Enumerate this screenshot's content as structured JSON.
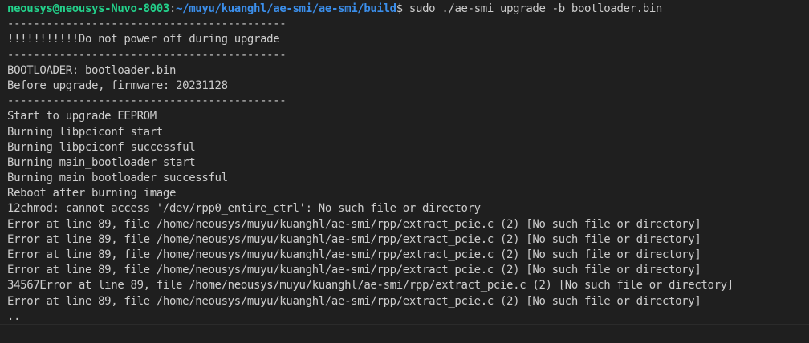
{
  "prompt": {
    "user_host": "neousys@neousys-Nuvo-8003",
    "separator": ":",
    "path": "~/muyu/kuanghl/ae-smi/ae-smi/build",
    "symbol": "$",
    "command": " sudo ./ae-smi upgrade -b bootloader.bin"
  },
  "output": [
    "-------------------------------------------",
    "!!!!!!!!!!!Do not power off during upgrade",
    "-------------------------------------------",
    "BOOTLOADER: bootloader.bin",
    "Before upgrade, firmware: 20231128",
    "-------------------------------------------",
    "Start to upgrade EEPROM",
    "Burning libpciconf start",
    "Burning libpciconf successful",
    "Burning main_bootloader start",
    "Burning main_bootloader successful",
    "Reboot after burning image",
    "12chmod: cannot access '/dev/rpp0_entire_ctrl': No such file or directory",
    "Error at line 89, file /home/neousys/muyu/kuanghl/ae-smi/rpp/extract_pcie.c (2) [No such file or directory]",
    "Error at line 89, file /home/neousys/muyu/kuanghl/ae-smi/rpp/extract_pcie.c (2) [No such file or directory]",
    "Error at line 89, file /home/neousys/muyu/kuanghl/ae-smi/rpp/extract_pcie.c (2) [No such file or directory]",
    "Error at line 89, file /home/neousys/muyu/kuanghl/ae-smi/rpp/extract_pcie.c (2) [No such file or directory]",
    "34567Error at line 89, file /home/neousys/muyu/kuanghl/ae-smi/rpp/extract_pcie.c (2) [No such file or directory]",
    "Error at line 89, file /home/neousys/muyu/kuanghl/ae-smi/rpp/extract_pcie.c (2) [No such file or directory]",
    ".."
  ],
  "colors": {
    "background": "#1f1f1f",
    "text": "#cccccc",
    "user_host": "#23d18b",
    "path": "#3b8eea"
  }
}
